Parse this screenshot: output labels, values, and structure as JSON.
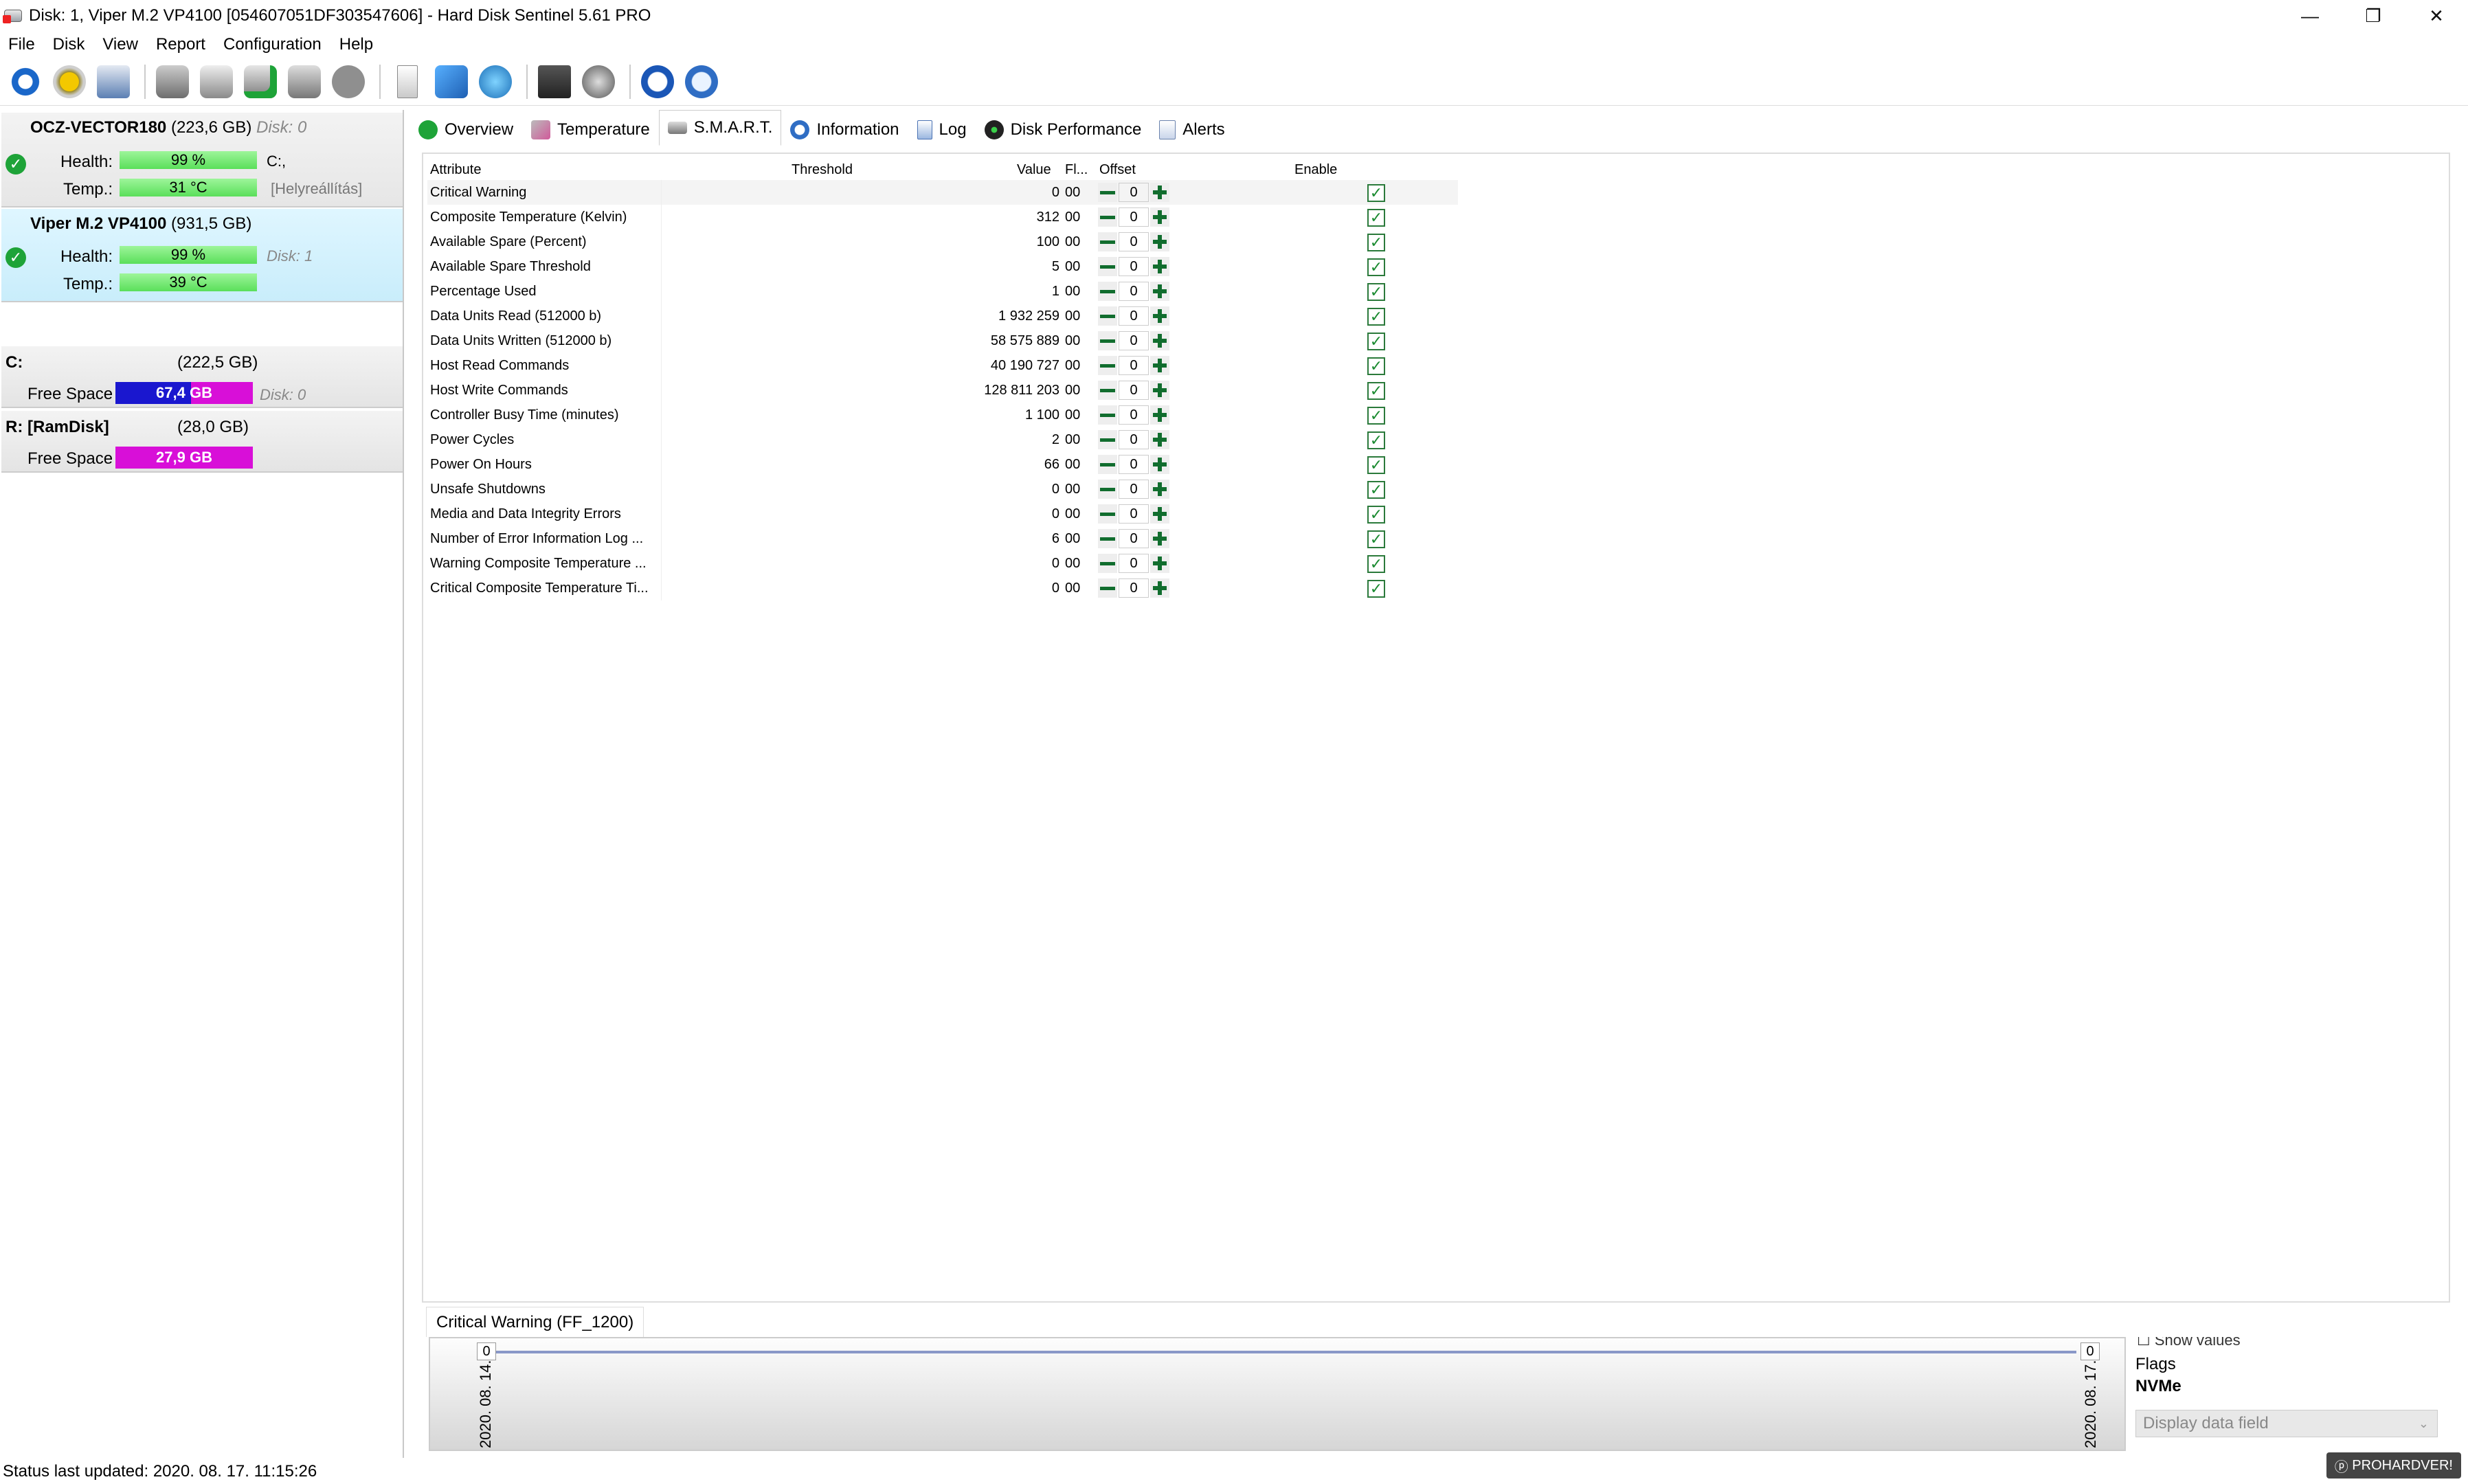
{
  "window": {
    "title": "Disk: 1, Viper M.2 VP4100 [054607051DF303547606]  -  Hard Disk Sentinel 5.61 PRO",
    "minimize": "—",
    "restore": "❐",
    "close": "✕"
  },
  "menu": [
    "File",
    "Disk",
    "View",
    "Report",
    "Configuration",
    "Help"
  ],
  "toolbar_icons": [
    "refresh-icon",
    "alert-icon",
    "disk-report-icon",
    "drive-icon",
    "drive-icon",
    "drive-check-icon",
    "drive-icon",
    "sleep-icon",
    "document-icon",
    "sync-icon",
    "network-icon",
    "test-icon",
    "sound-icon",
    "help-icon",
    "info-icon"
  ],
  "disks": [
    {
      "name": "OCZ-VECTOR180",
      "size": "(223,6 GB)",
      "disk": "Disk: 0",
      "health_label": "Health:",
      "health": "99 %",
      "health_fraction": 0.99,
      "temp_label": "Temp.:",
      "temp": "31 °C",
      "note1": "C:,",
      "note2": "[Helyreállítás]"
    },
    {
      "name": "Viper M.2 VP4100",
      "size": "(931,5 GB)",
      "disk": "Disk: 1",
      "health_label": "Health:",
      "health": "99 %",
      "health_fraction": 0.99,
      "temp_label": "Temp.:",
      "temp": "39 °C"
    }
  ],
  "volumes": [
    {
      "name": "C:",
      "size": "(222,5 GB)",
      "label": "Free Space",
      "free": "67,4 GB",
      "disk": "Disk: 0"
    },
    {
      "name": "R: [RamDisk]",
      "size": "(28,0 GB)",
      "label": "Free Space",
      "free": "27,9 GB"
    }
  ],
  "tabs": [
    "Overview",
    "Temperature",
    "S.M.A.R.T.",
    "Information",
    "Log",
    "Disk Performance",
    "Alerts"
  ],
  "active_tab": "S.M.A.R.T.",
  "smart": {
    "headers": {
      "attribute": "Attribute",
      "threshold": "Threshold",
      "value": "Value",
      "flags": "Fl...",
      "offset": "Offset",
      "enable": "Enable"
    },
    "rows": [
      {
        "attr": "Critical Warning",
        "value": "0",
        "fl": "00",
        "offset": "0"
      },
      {
        "attr": "Composite Temperature (Kelvin)",
        "value": "312",
        "fl": "00",
        "offset": "0"
      },
      {
        "attr": "Available Spare (Percent)",
        "value": "100",
        "fl": "00",
        "offset": "0"
      },
      {
        "attr": "Available Spare Threshold",
        "value": "5",
        "fl": "00",
        "offset": "0"
      },
      {
        "attr": "Percentage Used",
        "value": "1",
        "fl": "00",
        "offset": "0"
      },
      {
        "attr": "Data Units Read (512000 b)",
        "value": "1 932 259",
        "fl": "00",
        "offset": "0"
      },
      {
        "attr": "Data Units Written (512000 b)",
        "value": "58 575 889",
        "fl": "00",
        "offset": "0"
      },
      {
        "attr": "Host Read Commands",
        "value": "40 190 727",
        "fl": "00",
        "offset": "0"
      },
      {
        "attr": "Host Write Commands",
        "value": "128 811 203",
        "fl": "00",
        "offset": "0"
      },
      {
        "attr": "Controller Busy Time (minutes)",
        "value": "1 100",
        "fl": "00",
        "offset": "0"
      },
      {
        "attr": "Power Cycles",
        "value": "2",
        "fl": "00",
        "offset": "0"
      },
      {
        "attr": "Power On Hours",
        "value": "66",
        "fl": "00",
        "offset": "0"
      },
      {
        "attr": "Unsafe Shutdowns",
        "value": "0",
        "fl": "00",
        "offset": "0"
      },
      {
        "attr": "Media and Data Integrity Errors",
        "value": "0",
        "fl": "00",
        "offset": "0"
      },
      {
        "attr": "Number of Error Information Log ...",
        "value": "6",
        "fl": "00",
        "offset": "0"
      },
      {
        "attr": "Warning Composite Temperature ...",
        "value": "0",
        "fl": "00",
        "offset": "0"
      },
      {
        "attr": "Critical Composite Temperature Ti...",
        "value": "0",
        "fl": "00",
        "offset": "0"
      }
    ]
  },
  "graph": {
    "tab_label": "Critical Warning (FF_1200)",
    "left_value": "0",
    "right_value": "0",
    "date_start": "2020. 08. 14.",
    "date_end": "2020. 08. 17.",
    "show_values": "Show values",
    "flags_label": "Flags",
    "flags_value": "NVMe",
    "display_field": "Display data field"
  },
  "status": "Status last updated: 2020. 08. 17. 11:15:26",
  "watermark": "PROHARDVER!",
  "colors": {
    "green_bar": "#5adf5a",
    "blue_free": "#1a17cf",
    "magenta_free": "#d80fd8",
    "selected_disk": "#c9edfb",
    "ok": "#1ea338"
  }
}
